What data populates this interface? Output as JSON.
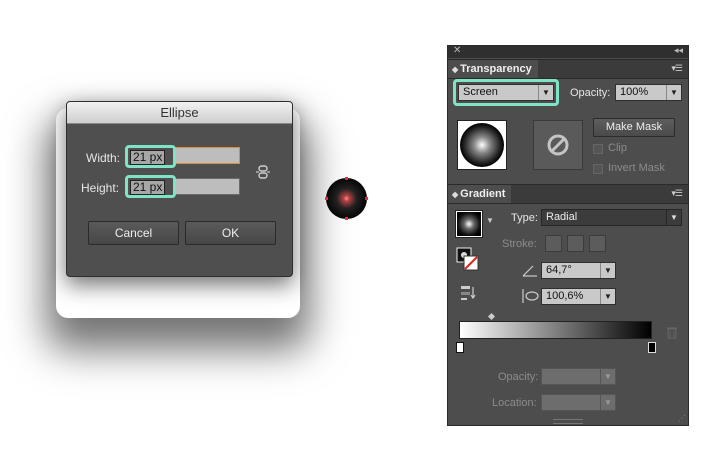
{
  "dialog": {
    "title": "Ellipse",
    "width_label": "Width:",
    "width_value": "21 px",
    "height_label": "Height:",
    "height_value": "21 px",
    "cancel_label": "Cancel",
    "ok_label": "OK"
  },
  "transparency": {
    "tab_label": "Transparency",
    "blend_mode": "Screen",
    "opacity_label": "Opacity:",
    "opacity_value": "100%",
    "make_mask_label": "Make Mask",
    "clip_label": "Clip",
    "invert_mask_label": "Invert Mask"
  },
  "gradient": {
    "tab_label": "Gradient",
    "type_label": "Type:",
    "type_value": "Radial",
    "stroke_label": "Stroke:",
    "angle_value": "64,7°",
    "aspect_value": "100,6%",
    "opacity_label": "Opacity:",
    "location_label": "Location:",
    "stops": [
      "#ffffff",
      "#000000"
    ]
  },
  "colors": {
    "highlight": "#7fe3c6",
    "focus_border": "#e08a40"
  }
}
